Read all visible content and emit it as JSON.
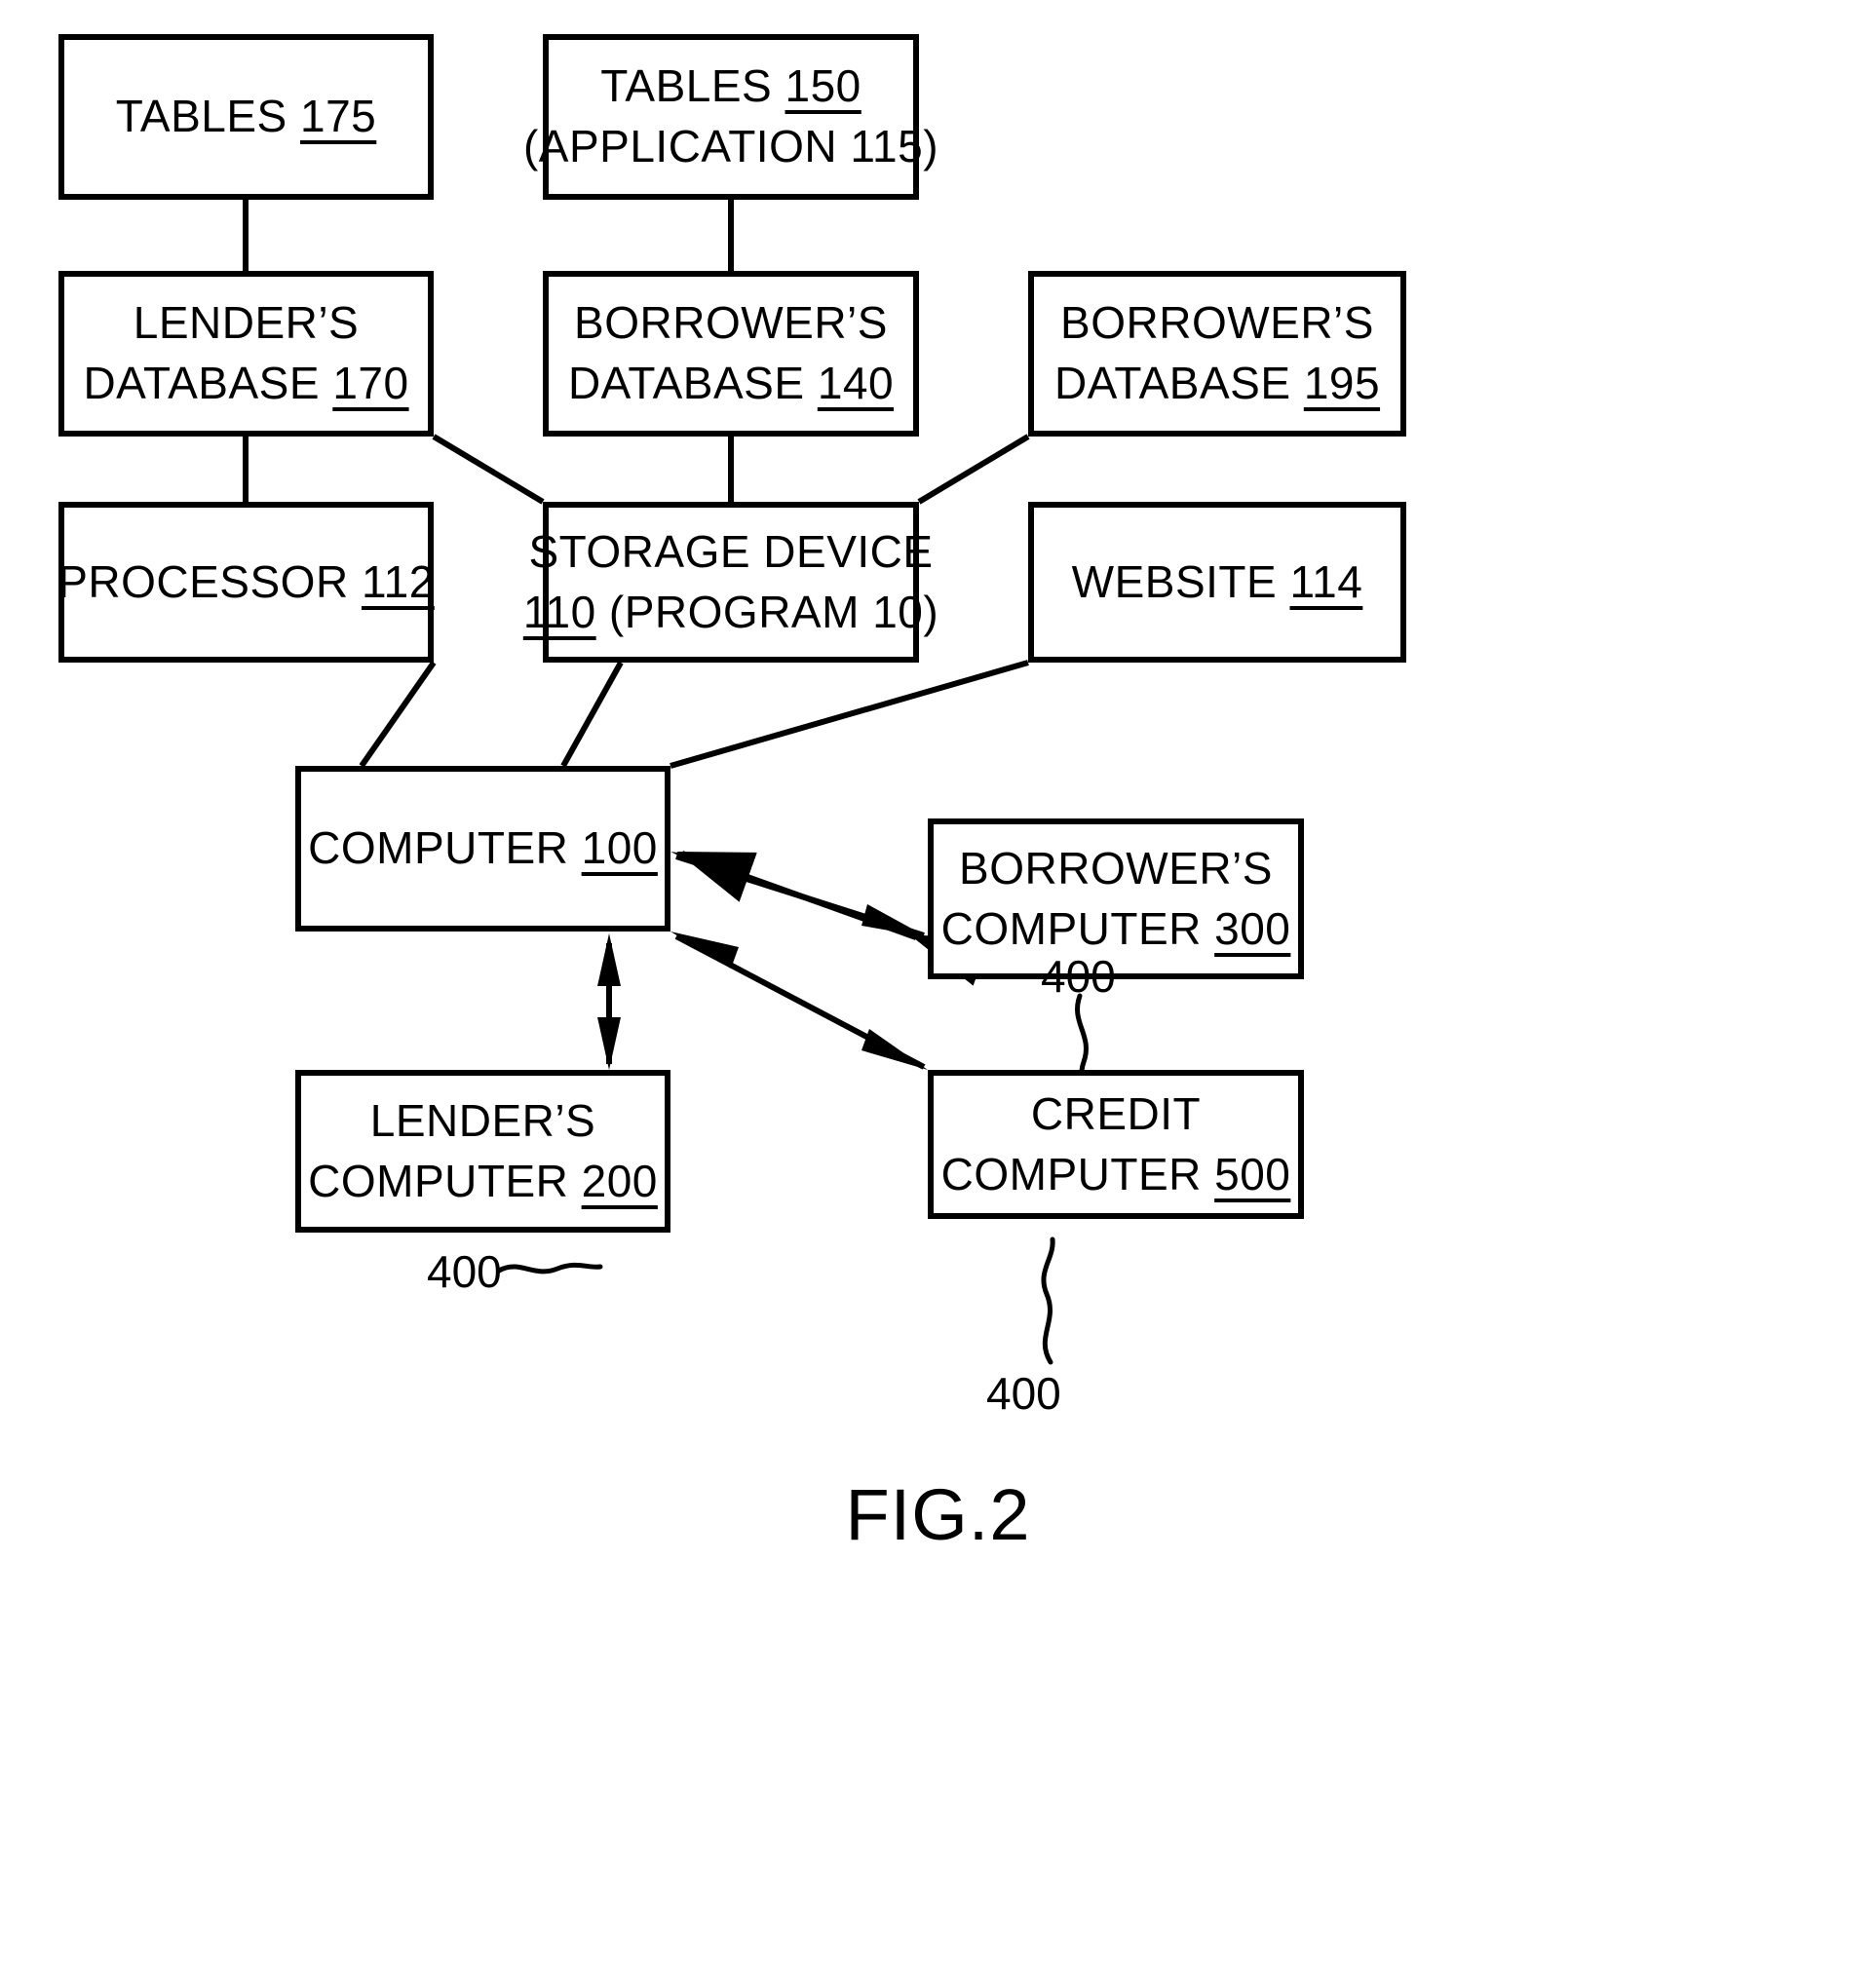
{
  "figure": {
    "caption": "FIG.2",
    "line_color": "#000000",
    "background_color": "#ffffff"
  },
  "nodes": {
    "tables_175": {
      "line1_text": "TABLES ",
      "line1_ref": "175"
    },
    "tables_150": {
      "line1_text": "TABLES ",
      "line1_ref": "150",
      "line2_text": "(APPLICATION  115)"
    },
    "lenders_database_170": {
      "line1_text": "LENDER’S",
      "line2_text": "DATABASE ",
      "line2_ref": "170"
    },
    "borrowers_database_140": {
      "line1_text": "BORROWER’S",
      "line2_text": "DATABASE ",
      "line2_ref": "140"
    },
    "borrowers_database_195": {
      "line1_text": "BORROWER’S",
      "line2_text": "DATABASE ",
      "line2_ref": "195"
    },
    "processor_112": {
      "line1_text": "PROCESSOR ",
      "line1_ref": "112"
    },
    "storage_device_110": {
      "line1_text": "STORAGE  DEVICE",
      "line2_ref": "110",
      "line2_text": " (PROGRAM  10)"
    },
    "website_114": {
      "line1_text": "WEBSITE ",
      "line1_ref": "114"
    },
    "computer_100": {
      "line1_text": "COMPUTER ",
      "line1_ref": "100"
    },
    "borrowers_computer_300": {
      "line1_text": "BORROWER’S",
      "line2_text": "COMPUTER ",
      "line2_ref": "300"
    },
    "lenders_computer_200": {
      "line1_text": "LENDER’S",
      "line2_text": "COMPUTER ",
      "line2_ref": "200"
    },
    "credit_computer_500": {
      "line1_text": "CREDIT",
      "line2_text": "COMPUTER ",
      "line2_ref": "500"
    }
  },
  "ref_labels": {
    "network_borrower": "400",
    "network_lender": "400",
    "network_credit": "400"
  }
}
